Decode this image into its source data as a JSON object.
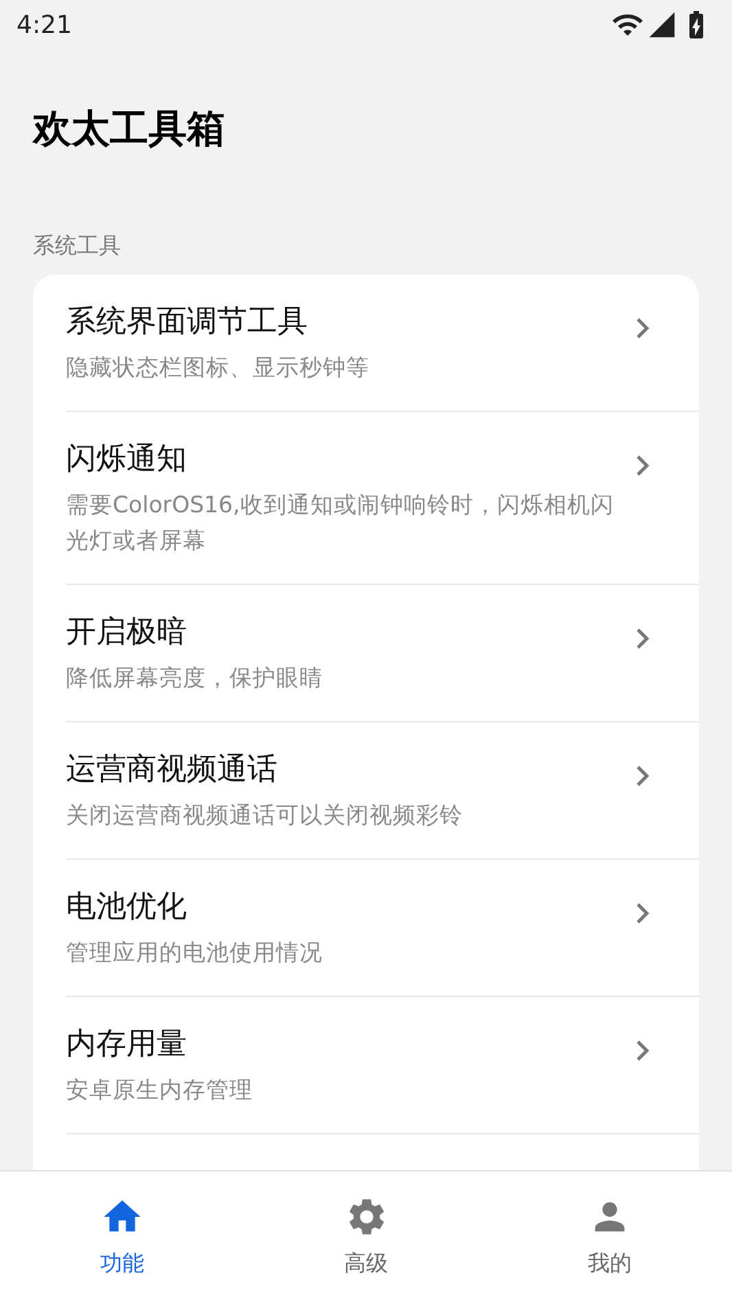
{
  "status_bar": {
    "time": "4:21"
  },
  "app": {
    "title": "欢太工具箱"
  },
  "section": {
    "label": "系统工具"
  },
  "items": [
    {
      "title": "系统界面调节工具",
      "subtitle": "隐藏状态栏图标、显示秒钟等"
    },
    {
      "title": "闪烁通知",
      "subtitle": "需要ColorOS16,收到通知或闹钟响铃时，闪烁相机闪光灯或者屏幕"
    },
    {
      "title": "开启极暗",
      "subtitle": "降低屏幕亮度，保护眼睛"
    },
    {
      "title": "运营商视频通话",
      "subtitle": "关闭运营商视频通话可以关闭视频彩铃"
    },
    {
      "title": "电池优化",
      "subtitle": "管理应用的电池使用情况"
    },
    {
      "title": "内存用量",
      "subtitle": "安卓原生内存管理"
    }
  ],
  "bottom_nav": [
    {
      "label": "功能",
      "kind": "home",
      "selected": true
    },
    {
      "label": "高级",
      "kind": "settings",
      "selected": false
    },
    {
      "label": "我的",
      "kind": "profile",
      "selected": false
    }
  ]
}
